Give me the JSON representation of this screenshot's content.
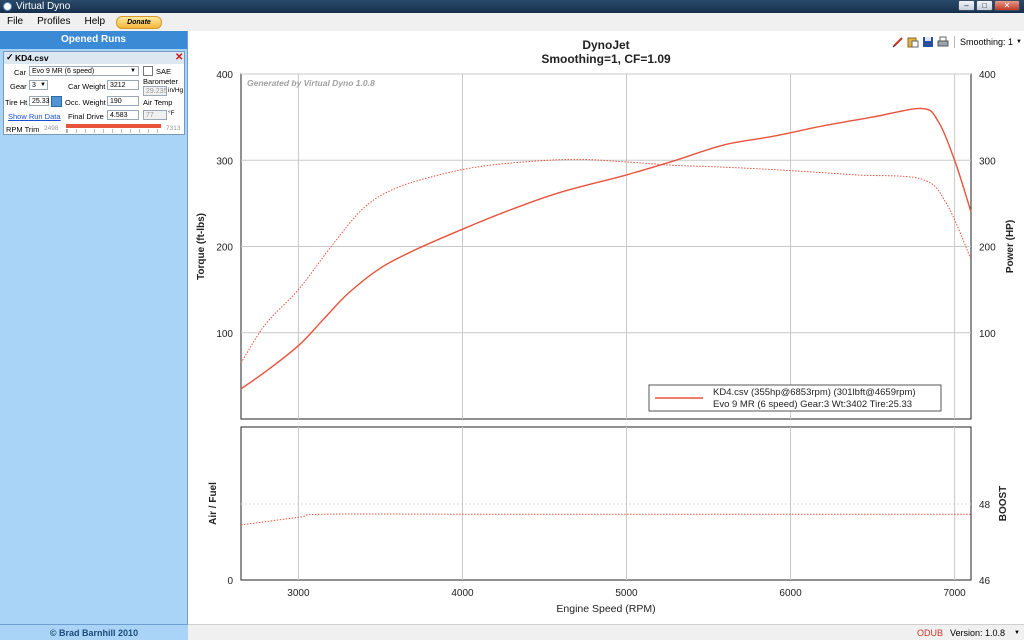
{
  "window": {
    "title": "Virtual Dyno"
  },
  "menu": {
    "file": "File",
    "profiles": "Profiles",
    "help": "Help",
    "donate": "Donate"
  },
  "sidebar": {
    "title": "Opened Runs",
    "run": {
      "filename": "KD4.csv",
      "car_label": "Car",
      "car_value": "Evo 9 MR (6 speed)",
      "sae_label": "SAE",
      "gear_label": "Gear",
      "gear_value": "3",
      "car_weight_label": "Car Weight",
      "car_weight_value": "3212",
      "barometer_label": "Barometer",
      "barometer_value": "29.235",
      "barometer_unit": "in/Hg",
      "tire_label": "Tire Ht",
      "tire_value": "25.33",
      "occ_weight_label": "Occ. Weight",
      "occ_weight_value": "190",
      "air_temp_label": "Air Temp",
      "air_temp_value": "77",
      "air_temp_unit": "°F",
      "show_run_data": "Show Run Data",
      "final_drive_label": "Final Drive",
      "final_drive_value": "4.583",
      "rpm_trim_label": "RPM Trim",
      "rpm_trim_min": "2498",
      "rpm_trim_max": "7313"
    },
    "footer": "© Brad Barnhill 2010"
  },
  "toolbar": {
    "smoothing": "Smoothing: 1"
  },
  "status": {
    "odub": "ODUB",
    "version": "Version: 1.0.8"
  },
  "colors": {
    "curve": "#e8533c",
    "accent": "#3b8ad6"
  },
  "chart_data": [
    {
      "type": "line",
      "title": "DynoJet",
      "subtitle": "Smoothing=1, CF=1.09",
      "watermark": "Generated by Virtual Dyno 1.0.8",
      "ylabel": "Torque (ft-lbs)",
      "y2label": "Power (HP)",
      "xlim": [
        2650,
        7100
      ],
      "ylim": [
        0,
        400
      ],
      "xticks": [
        "3000",
        "4000",
        "5000",
        "6000",
        "7000"
      ],
      "yticks": [
        "100",
        "200",
        "300",
        "400"
      ],
      "grid": true,
      "legend_position": "bottom-right",
      "legend": [
        "KD4.csv (355hp@6853rpm) (301lbft@4659rpm)",
        "Evo 9 MR (6 speed) Gear:3 Wt:3402 Tire:25.33"
      ],
      "series": [
        {
          "name": "Power (HP)",
          "style": "solid",
          "x": [
            2650,
            2800,
            3000,
            3150,
            3300,
            3500,
            3700,
            4000,
            4300,
            4600,
            5000,
            5300,
            5600,
            5900,
            6200,
            6500,
            6800,
            6900,
            7000,
            7100
          ],
          "y": [
            35,
            55,
            85,
            115,
            145,
            175,
            195,
            220,
            243,
            263,
            283,
            300,
            318,
            328,
            340,
            350,
            360,
            345,
            300,
            240
          ]
        },
        {
          "name": "Torque (ft-lbs)",
          "style": "dotted",
          "x": [
            2650,
            2800,
            3000,
            3200,
            3400,
            3600,
            3900,
            4200,
            4659,
            5000,
            5300,
            5600,
            6000,
            6400,
            6800,
            6950,
            7100
          ],
          "y": [
            65,
            110,
            150,
            200,
            245,
            268,
            285,
            295,
            301,
            298,
            294,
            292,
            288,
            283,
            278,
            250,
            185
          ]
        }
      ]
    },
    {
      "type": "line",
      "xlabel": "Engine Speed (RPM)",
      "ylabel": "Air / Fuel",
      "y2label": "BOOST",
      "xlim": [
        2650,
        7100
      ],
      "ylim": [
        0,
        1
      ],
      "yticks": [
        "0"
      ],
      "y2ticks": [
        "46",
        "48"
      ],
      "grid": true,
      "series": [
        {
          "name": "Air / Fuel",
          "style": "dotted",
          "x": [
            2650,
            3000,
            3150,
            4000,
            5000,
            6000,
            7100
          ],
          "y": [
            0.36,
            0.41,
            0.43,
            0.43,
            0.43,
            0.43,
            0.43
          ]
        }
      ]
    }
  ]
}
